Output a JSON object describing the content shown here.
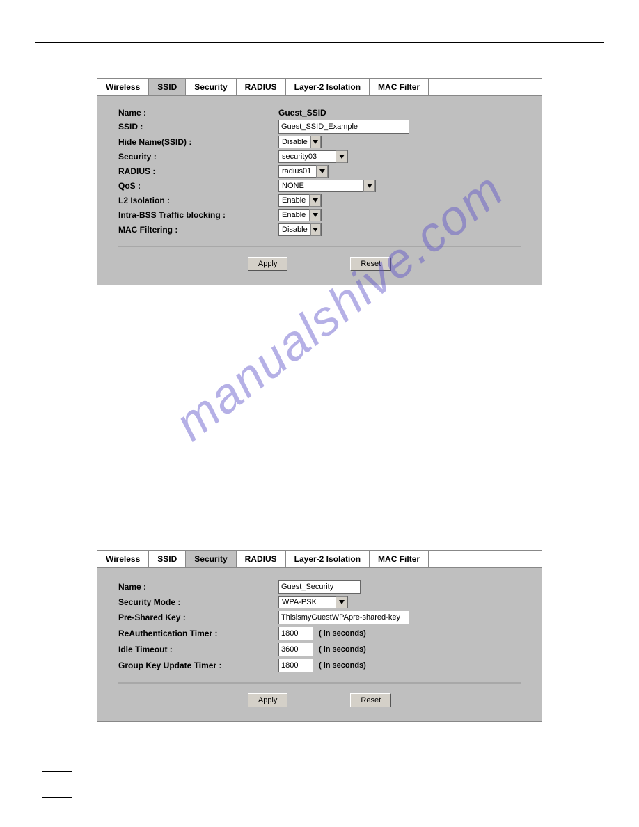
{
  "watermark": "manualshive.com",
  "topPanel": {
    "tabs": [
      "Wireless",
      "SSID",
      "Security",
      "RADIUS",
      "Layer-2 Isolation",
      "MAC Filter"
    ],
    "activeTab": "SSID",
    "nameLabel": "Name :",
    "nameValue": "Guest_SSID",
    "ssidLabel": "SSID :",
    "ssidValue": "Guest_SSID_Example",
    "hideNameLabel": "Hide Name(SSID) :",
    "hideNameValue": "Disable",
    "securityLabel": "Security :",
    "securityValue": "security03",
    "radiusLabel": "RADIUS :",
    "radiusValue": "radius01",
    "qosLabel": "QoS :",
    "qosValue": "NONE",
    "l2Label": "L2 Isolation :",
    "l2Value": "Enable",
    "intraLabel": "Intra-BSS Traffic blocking :",
    "intraValue": "Enable",
    "macLabel": "MAC Filtering :",
    "macValue": "Disable",
    "applyLabel": "Apply",
    "resetLabel": "Reset"
  },
  "bottomPanel": {
    "tabs": [
      "Wireless",
      "SSID",
      "Security",
      "RADIUS",
      "Layer-2 Isolation",
      "MAC Filter"
    ],
    "activeTab": "Security",
    "nameLabel": "Name :",
    "nameValue": "Guest_Security",
    "modeLabel": "Security Mode :",
    "modeValue": "WPA-PSK",
    "pskLabel": "Pre-Shared Key :",
    "pskValue": "ThisismyGuestWPApre-shared-key",
    "reauthLabel": "ReAuthentication Timer :",
    "reauthValue": "1800",
    "idleLabel": "Idle Timeout :",
    "idleValue": "3600",
    "groupLabel": "Group Key Update Timer :",
    "groupValue": "1800",
    "secondsSuffix": "( in seconds)",
    "applyLabel": "Apply",
    "resetLabel": "Reset"
  }
}
